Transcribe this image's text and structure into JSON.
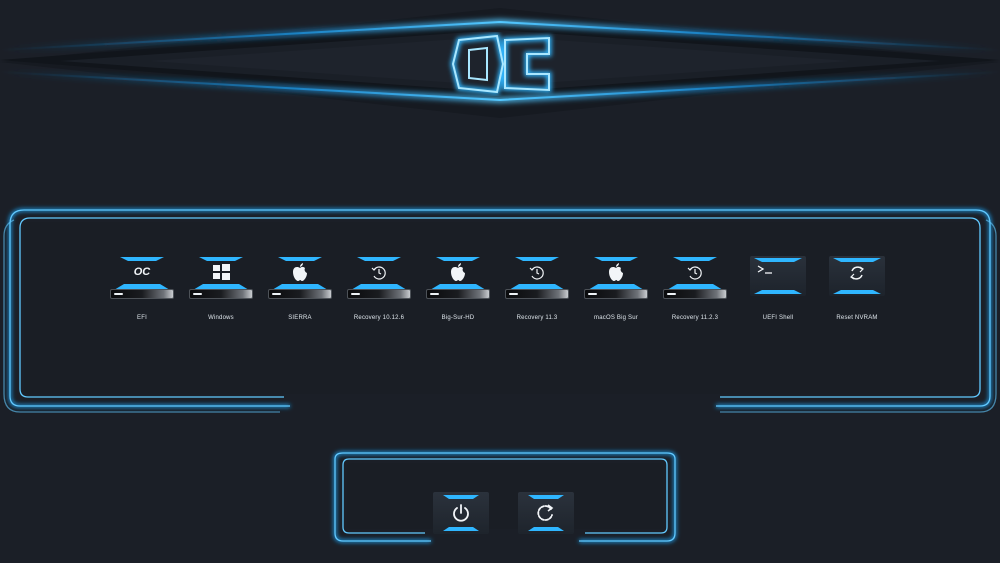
{
  "logo": {
    "text": "OC",
    "icon": "opencore-logo"
  },
  "colors": {
    "accent": "#1ea7ff",
    "accent_light": "#7fd6ff",
    "background": "#1b1f27",
    "tile": "#262c35"
  },
  "boot_entries": [
    {
      "label": "EFI",
      "icon": "opencore-icon",
      "kind": "drive"
    },
    {
      "label": "Windows",
      "icon": "windows-icon",
      "kind": "drive"
    },
    {
      "label": "SIERRA",
      "icon": "apple-icon",
      "kind": "drive"
    },
    {
      "label": "Recovery 10.12.6",
      "icon": "recovery-icon",
      "kind": "drive"
    },
    {
      "label": "Big-Sur-HD",
      "icon": "apple-icon",
      "kind": "drive"
    },
    {
      "label": "Recovery 11.3",
      "icon": "recovery-icon",
      "kind": "drive"
    },
    {
      "label": "macOS Big Sur",
      "icon": "apple-icon",
      "kind": "drive"
    },
    {
      "label": "Recovery 11.2.3",
      "icon": "recovery-icon",
      "kind": "drive"
    },
    {
      "label": "UEFI Shell",
      "icon": "terminal-icon",
      "kind": "tool"
    },
    {
      "label": "Reset NVRAM",
      "icon": "reset-icon",
      "kind": "tool"
    }
  ],
  "actions": [
    {
      "name": "shutdown",
      "icon": "power-icon"
    },
    {
      "name": "restart",
      "icon": "restart-icon"
    }
  ]
}
